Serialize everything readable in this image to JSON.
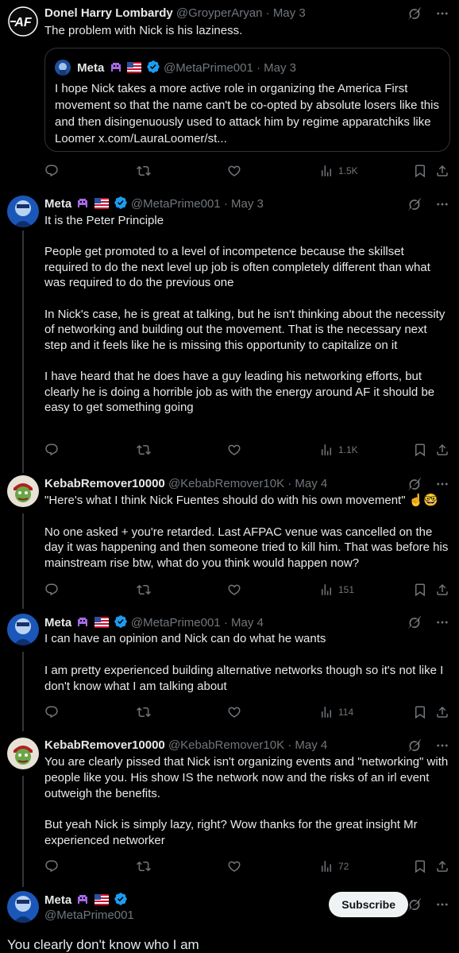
{
  "colors": {
    "background": "#000000",
    "text": "#e7e9ea",
    "muted": "#71767b",
    "verified": "#1d9bf0",
    "border": "#2f3336"
  },
  "post1": {
    "name": "Donel Harry Lombardy",
    "meta": "@GroyperAryan · May 3",
    "text": "The problem with Nick is his laziness.",
    "quote": {
      "name": "Meta",
      "meta": "@MetaPrime001 · May 3",
      "text": "I hope Nick takes a more active role in organizing the America First movement so that the name can't be co-opted by absolute losers like this and then disingenuously used to attack him by regime apparatchiks like Loomer x.com/LauraLoomer/st..."
    },
    "views": "1.5K"
  },
  "post2": {
    "name": "Meta",
    "meta": "@MetaPrime001 · May 3",
    "text": "It is the Peter Principle\n\nPeople get promoted to a level of incompetence because the skillset required to do the next level up job is often completely different than what was required to do the previous one\n\nIn Nick's case, he is great at talking, but he isn't thinking about the necessity of networking and building out the movement. That is the necessary next step and it feels like he is missing this opportunity to capitalize on it\n\nI have heard that he does have a guy leading his networking efforts, but clearly he is doing a horrible job as with the energy around AF it should be easy to get something going",
    "views": "1.1K"
  },
  "post3": {
    "name": "KebabRemover10000",
    "meta": "@KebabRemover10K · May 4",
    "text": "\"Here's what I think Nick Fuentes should do with his own movement\" ☝️🤓\n\nNo one asked + you're retarded. Last AFPAC venue was cancelled on the day it was happening and then someone tried to kill him. That was before his mainstream rise btw, what do you think would happen now?",
    "views": "151"
  },
  "post4": {
    "name": "Meta",
    "meta": "@MetaPrime001 · May 4",
    "text": "I can have an opinion and Nick can do what he wants\n\nI am pretty experienced building alternative networks though so it's not like I don't know what I am talking about",
    "views": "114"
  },
  "post5": {
    "name": "KebabRemover10000",
    "meta": "@KebabRemover10K · May 4",
    "text": "You are clearly pissed that Nick isn't organizing events and \"networking\" with people like you. His show IS the network now and the risks of an irl event outweigh the benefits.\n\nBut yeah Nick is simply lazy, right? Wow thanks for the great insight Mr experienced networker",
    "views": "72"
  },
  "post6": {
    "name": "Meta",
    "handle": "@MetaPrime001",
    "subscribe": "Subscribe",
    "text": "You clearly don't know who I am"
  },
  "icons": [
    "grok-icon",
    "more-icon",
    "reply-icon",
    "repost-icon",
    "like-icon",
    "views-icon",
    "bookmark-icon",
    "share-icon",
    "verified-icon",
    "alien-emoji",
    "us-flag-emoji"
  ]
}
